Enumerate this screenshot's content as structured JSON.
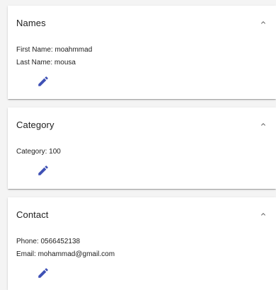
{
  "panels": [
    {
      "title": "Names",
      "fields": [
        {
          "label": "First Name: ",
          "value": "moahmmad"
        },
        {
          "label": "Last Name: ",
          "value": "mousa"
        }
      ]
    },
    {
      "title": "Category",
      "fields": [
        {
          "label": "Category: ",
          "value": "100"
        }
      ]
    },
    {
      "title": "Contact",
      "fields": [
        {
          "label": "Phone: ",
          "value": "0566452138"
        },
        {
          "label": "Email: ",
          "value": "mohammad@gmail.com"
        }
      ]
    }
  ],
  "icons": {
    "expand": "chevron-up-icon",
    "edit": "pencil-icon"
  },
  "colors": {
    "accent": "#3f51b5",
    "background": "#f4f4f4",
    "panel": "#ffffff",
    "text": "#212121",
    "chevron": "#616161"
  }
}
